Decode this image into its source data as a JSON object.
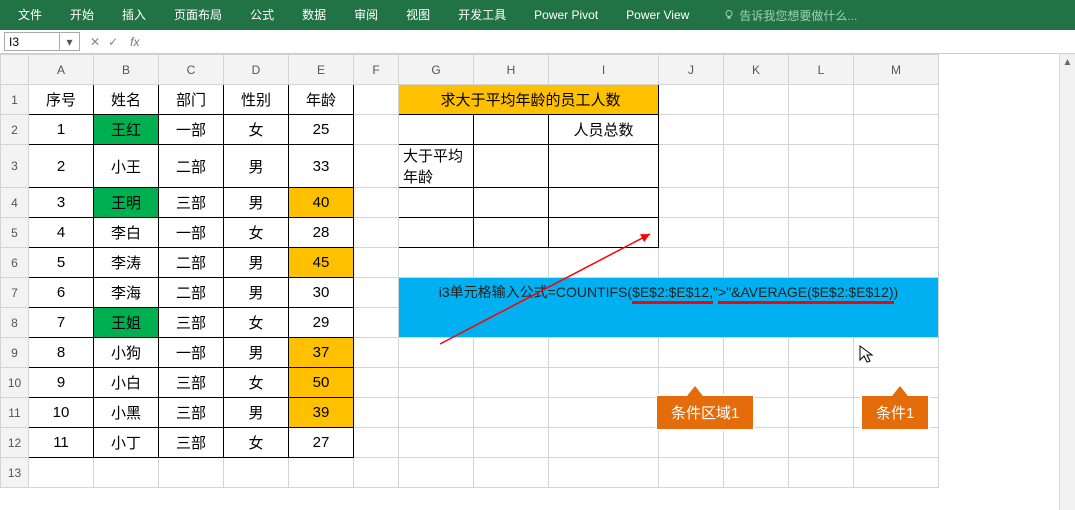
{
  "ribbon": {
    "tabs": [
      "文件",
      "开始",
      "插入",
      "页面布局",
      "公式",
      "数据",
      "审阅",
      "视图",
      "开发工具",
      "Power Pivot",
      "Power View"
    ],
    "tell_me": "告诉我您想要做什么..."
  },
  "name_box": "I3",
  "formula_bar": "",
  "column_headers": [
    "A",
    "B",
    "C",
    "D",
    "E",
    "F",
    "G",
    "H",
    "I",
    "J",
    "K",
    "L",
    "M"
  ],
  "row_headers": [
    "1",
    "2",
    "3",
    "4",
    "5",
    "6",
    "7",
    "8",
    "9",
    "10",
    "11",
    "12",
    "13"
  ],
  "table_header": {
    "c1": "序号",
    "c2": "姓名",
    "c3": "部门",
    "c4": "性别",
    "c5": "年龄"
  },
  "rows": [
    {
      "id": "1",
      "name": "王红",
      "dept": "一部",
      "sex": "女",
      "age": "25",
      "name_hl": true,
      "age_hl": false
    },
    {
      "id": "2",
      "name": "小王",
      "dept": "二部",
      "sex": "男",
      "age": "33",
      "name_hl": false,
      "age_hl": false
    },
    {
      "id": "3",
      "name": "王明",
      "dept": "三部",
      "sex": "男",
      "age": "40",
      "name_hl": true,
      "age_hl": true
    },
    {
      "id": "4",
      "name": "李白",
      "dept": "一部",
      "sex": "女",
      "age": "28",
      "name_hl": false,
      "age_hl": false
    },
    {
      "id": "5",
      "name": "李涛",
      "dept": "二部",
      "sex": "男",
      "age": "45",
      "name_hl": false,
      "age_hl": true
    },
    {
      "id": "6",
      "name": "李海",
      "dept": "二部",
      "sex": "男",
      "age": "30",
      "name_hl": false,
      "age_hl": false
    },
    {
      "id": "7",
      "name": "王姐",
      "dept": "三部",
      "sex": "女",
      "age": "29",
      "name_hl": true,
      "age_hl": false
    },
    {
      "id": "8",
      "name": "小狗",
      "dept": "一部",
      "sex": "男",
      "age": "37",
      "name_hl": false,
      "age_hl": true
    },
    {
      "id": "9",
      "name": "小白",
      "dept": "三部",
      "sex": "女",
      "age": "50",
      "name_hl": false,
      "age_hl": true
    },
    {
      "id": "10",
      "name": "小黑",
      "dept": "三部",
      "sex": "男",
      "age": "39",
      "name_hl": false,
      "age_hl": true
    },
    {
      "id": "11",
      "name": "小丁",
      "dept": "三部",
      "sex": "女",
      "age": "27",
      "name_hl": false,
      "age_hl": false
    }
  ],
  "summary": {
    "title": "求大于平均年龄的员工人数",
    "col_label": "人员总数",
    "row_label": "大于平均年龄"
  },
  "formula_banner": {
    "prefix": "i3单元格输入公式=COUNTIFS(",
    "part1": "$E$2:$E$12,",
    "mid": "\"",
    "part2": ">\"&AVERAGE($E$2:$E$12)",
    "suffix": ")"
  },
  "callouts": {
    "left": "条件区域1",
    "right": "条件1"
  },
  "col_widths": {
    "rowhdr": 28,
    "A": 65,
    "B": 65,
    "C": 65,
    "D": 65,
    "E": 65,
    "F": 45,
    "G": 75,
    "H": 75,
    "I": 110,
    "J": 65,
    "K": 65,
    "L": 65,
    "M": 85
  }
}
